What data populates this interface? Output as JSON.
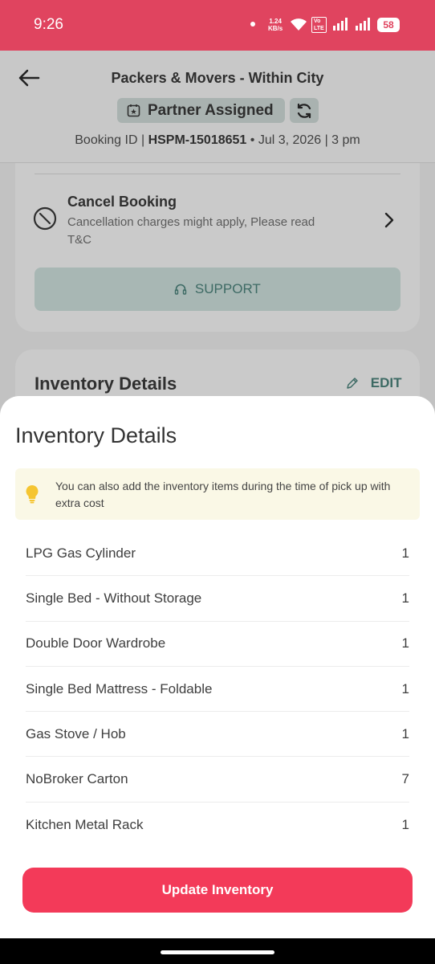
{
  "status_bar": {
    "time": "9:26",
    "speed_value": "1.24",
    "speed_unit": "KB/s",
    "volte_top": "Vo",
    "volte_bottom": "LTE",
    "battery": "58"
  },
  "header": {
    "title": "Packers & Movers - Within City",
    "status_badge": "Partner Assigned",
    "booking_label": "Booking ID |",
    "booking_id": "HSPM-15018651",
    "booking_separator": "•",
    "booking_date": "Jul 3, 2026 | 3 pm"
  },
  "cancel": {
    "title": "Cancel Booking",
    "subtitle": "Cancellation charges might apply, Please read T&C"
  },
  "support_label": "SUPPORT",
  "inventory_card": {
    "title": "Inventory Details",
    "edit_label": "EDIT"
  },
  "sheet": {
    "title": "Inventory Details",
    "info": "You can also add the inventory items during the time of pick up with extra cost",
    "items": [
      {
        "name": "LPG Gas Cylinder",
        "qty": "1"
      },
      {
        "name": "Single Bed - Without Storage",
        "qty": "1"
      },
      {
        "name": "Double Door Wardrobe",
        "qty": "1"
      },
      {
        "name": "Single Bed Mattress - Foldable",
        "qty": "1"
      },
      {
        "name": "Gas Stove / Hob",
        "qty": "1"
      },
      {
        "name": "NoBroker Carton",
        "qty": "7"
      },
      {
        "name": "Kitchen Metal Rack",
        "qty": "1"
      }
    ],
    "update_label": "Update Inventory"
  },
  "colors": {
    "status_bar": "#e0445f",
    "primary_button": "#f33a59",
    "accent_teal": "#3d6a64",
    "info_bg": "#faf8e6"
  }
}
